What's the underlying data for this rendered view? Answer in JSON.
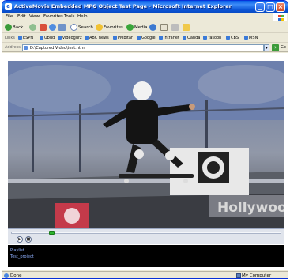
{
  "window": {
    "title": "ActiveMovie Embedded MPG Object Test Page - Microsoft Internet Explorer",
    "title_display": "ActiveMovie Embedded MPG Object Test Page - Microsoft Internet Explorer",
    "controls": {
      "minimize": "_",
      "maximize": "□",
      "close": "×"
    }
  },
  "menu": {
    "items": [
      "File",
      "Edit",
      "View",
      "Favorites",
      "Tools",
      "Help"
    ]
  },
  "toolbar": {
    "back": "Back",
    "search": "Search",
    "favorites": "Favorites",
    "media": "Media"
  },
  "links": {
    "label": "Links",
    "items": [
      "ESPN",
      "Ubud",
      "videogurz",
      "ABC news",
      "PMbitar",
      "Google",
      "Intranet",
      "Oanda",
      "Yasoon",
      "CBS",
      "MSN"
    ]
  },
  "address": {
    "label": "Address",
    "value": "D:\\Captured Video\\test.htm",
    "go_label": "Go"
  },
  "player": {
    "seek_fraction": 0.15,
    "video_sign_text": "Hollywood",
    "playlist_lines": [
      "Playlist",
      "Test_project"
    ]
  },
  "status": {
    "text": "Done",
    "zone": "My Computer"
  },
  "colors": {
    "titlebar": "#0a5fe8",
    "chrome": "#ece9d8",
    "playlist_bg": "#000000",
    "playlist_text": "#8fb0ff"
  }
}
